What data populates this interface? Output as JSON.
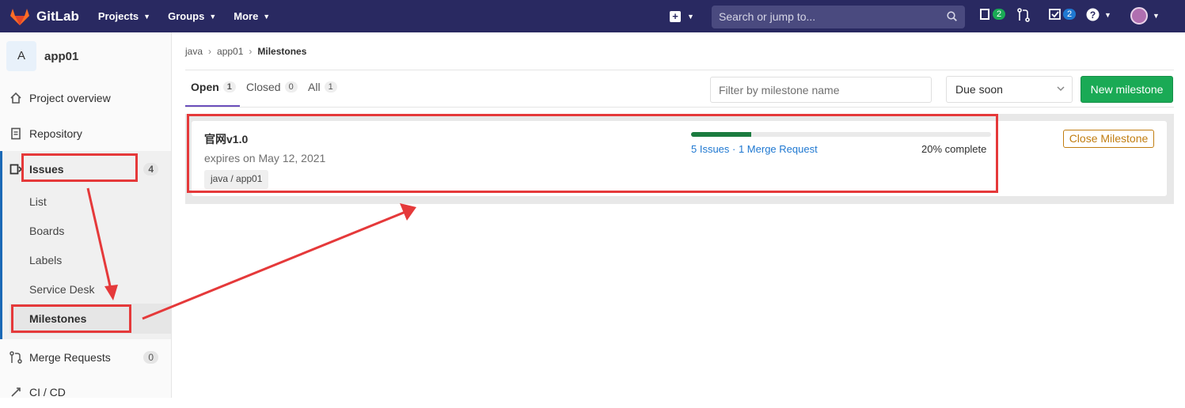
{
  "navbar": {
    "brand": "GitLab",
    "menu": [
      {
        "label": "Projects"
      },
      {
        "label": "Groups"
      },
      {
        "label": "More"
      }
    ],
    "search_placeholder": "Search or jump to...",
    "issues_badge": "2",
    "todos_badge": "2",
    "icons": [
      "gitlab-logo",
      "plus-icon",
      "search-icon",
      "issues-icon",
      "merge-request-icon",
      "todo-icon",
      "help-icon",
      "user-avatar"
    ]
  },
  "sidebar": {
    "project_initial": "A",
    "project_name": "app01",
    "items": [
      {
        "label": "Project overview",
        "icon": "home-icon"
      },
      {
        "label": "Repository",
        "icon": "doc-icon"
      },
      {
        "label": "Issues",
        "icon": "issues-icon",
        "count": "4"
      },
      {
        "label": "Merge Requests",
        "icon": "merge-request-icon",
        "count": "0"
      },
      {
        "label": "CI / CD",
        "icon": "rocket-icon"
      }
    ],
    "issues_sub": [
      "List",
      "Boards",
      "Labels",
      "Service Desk",
      "Milestones"
    ]
  },
  "breadcrumb": {
    "items": [
      "java",
      "app01",
      "Milestones"
    ]
  },
  "tabs": [
    {
      "label": "Open",
      "count": "1"
    },
    {
      "label": "Closed",
      "count": "0"
    },
    {
      "label": "All",
      "count": "1"
    }
  ],
  "filter": {
    "placeholder": "Filter by milestone name"
  },
  "sort": {
    "value": "Due soon"
  },
  "new_milestone_label": "New milestone",
  "milestone": {
    "title": "官网v1.0",
    "expires": "expires on May 12, 2021",
    "tag": "java / app01",
    "links": "5 Issues · 1 Merge Request",
    "complete": "20% complete",
    "progress": 0.2,
    "close_label": "Close Milestone"
  },
  "colors": {
    "navbar": "#292961",
    "accent": "#1aaa55",
    "annotation": "#e5393a",
    "warning": "#c17d10"
  }
}
